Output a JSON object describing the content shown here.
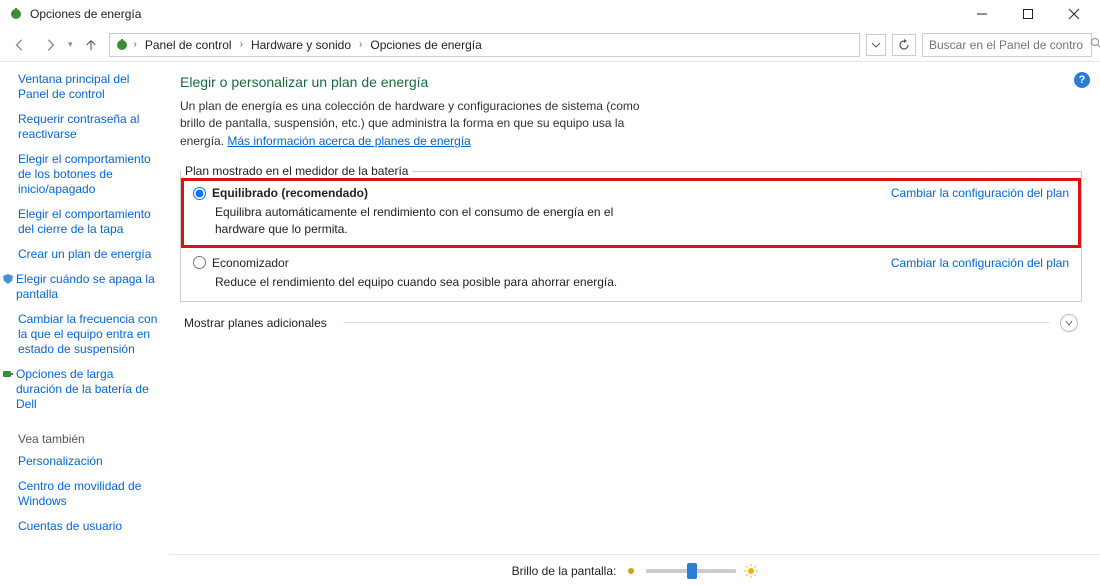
{
  "window": {
    "title": "Opciones de energía"
  },
  "breadcrumb": {
    "items": [
      "Panel de control",
      "Hardware y sonido",
      "Opciones de energía"
    ]
  },
  "search": {
    "placeholder": "Buscar en el Panel de control"
  },
  "sidebar": {
    "links": [
      "Ventana principal del Panel de control",
      "Requerir contraseña al reactivarse",
      "Elegir el comportamiento de los botones de inicio/apagado",
      "Elegir el comportamiento del cierre de la tapa",
      "Crear un plan de energía",
      "Elegir cuándo se apaga la pantalla",
      "Cambiar la frecuencia con la que el equipo entra en estado de suspensión",
      "Opciones de larga duración de la batería de Dell"
    ],
    "see_also_title": "Vea también",
    "see_also": [
      "Personalización",
      "Centro de movilidad de Windows",
      "Cuentas de usuario"
    ]
  },
  "main": {
    "title": "Elegir o personalizar un plan de energía",
    "description": "Un plan de energía es una colección de hardware y configuraciones de sistema (como brillo de pantalla, suspensión, etc.) que administra la forma en que su equipo usa la energía. ",
    "more_link": "Más información acerca de planes de energía",
    "group_label": "Plan mostrado en el medidor de la batería",
    "plans": [
      {
        "name": "Equilibrado (recomendado)",
        "desc": "Equilibra automáticamente el rendimiento con el consumo de energía en el hardware que lo permita.",
        "change": "Cambiar la configuración del plan",
        "selected": true
      },
      {
        "name": "Economizador",
        "desc": "Reduce el rendimiento del equipo cuando sea posible para ahorrar energía.",
        "change": "Cambiar la configuración del plan",
        "selected": false
      }
    ],
    "additional": "Mostrar planes adicionales"
  },
  "bottom": {
    "label": "Brillo de la pantalla:",
    "slider_pct": 45
  }
}
